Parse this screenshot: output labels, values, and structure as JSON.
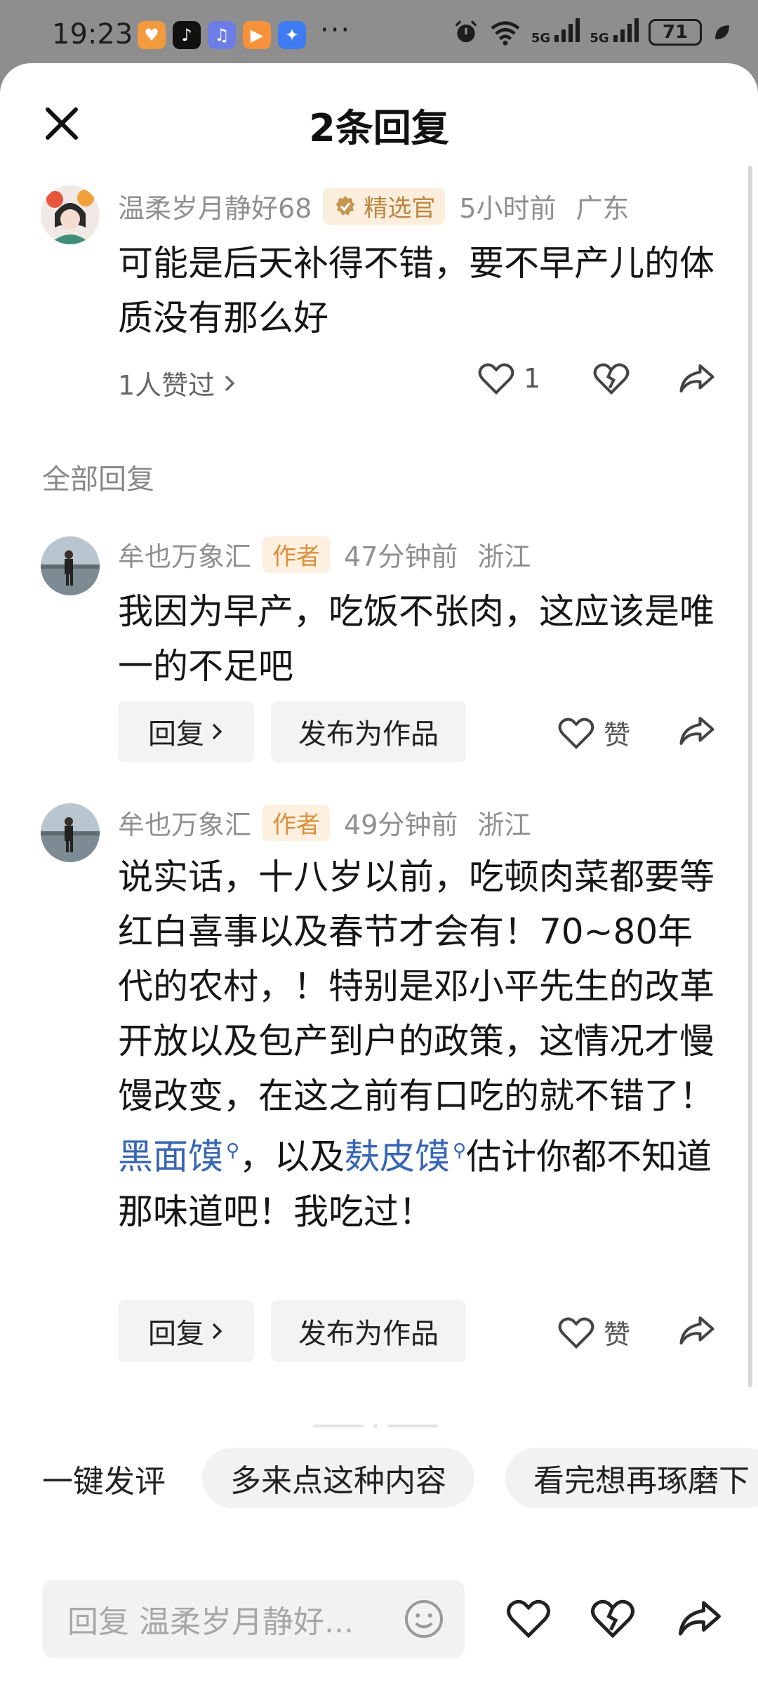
{
  "status_bar": {
    "time": "19:23",
    "app_icons": [
      "heart-app-icon",
      "tiktok-app-icon",
      "music-app-icon",
      "video-app-icon",
      "compass-app-icon"
    ],
    "more": "···",
    "signal_1": "5G",
    "signal_2": "5G",
    "battery": "71"
  },
  "header": {
    "title": "2条回复",
    "close_icon": "close-icon"
  },
  "top_comment": {
    "user": "温柔岁月静好68",
    "badge": "精选官",
    "time": "5小时前",
    "location": "广东",
    "text": "可能是后天补得不错，要不早产儿的体质没有那么好",
    "likes_summary": "1人赞过",
    "like_count": "1"
  },
  "section_label": "全部回复",
  "replies": [
    {
      "user": "牟也万象汇",
      "badge": "作者",
      "time": "47分钟前",
      "location": "浙江",
      "text": "我因为早产，吃饭不张肉，这应该是唯一的不足吧",
      "reply_label": "回复",
      "publish_label": "发布为作品",
      "like_label": "赞"
    },
    {
      "user": "牟也万象汇",
      "badge": "作者",
      "time": "49分钟前",
      "location": "浙江",
      "text_part1": "说实话，十八岁以前，吃顿肉菜都要等红白喜事以及春节才会有！70~80年代的农村，！特别是邓小平先生的改革开放以及包产到户的政策，这情况才慢馒改变，在这之前有口吃的就不错了！",
      "link1": "黑面馍",
      "text_part2": "，以及",
      "link2": "麸皮馍",
      "text_part3": "估计你都不知道那味道吧！我吃过！",
      "reply_label": "回复",
      "publish_label": "发布为作品",
      "like_label": "赞"
    }
  ],
  "quick_comment": {
    "label": "一键发评",
    "chips": [
      "多来点这种内容",
      "看完想再琢磨下"
    ]
  },
  "reply_input": {
    "placeholder": "回复 温柔岁月静好..."
  },
  "colors": {
    "link": "#3766b3",
    "selected_badge_text": "#b98640",
    "author_badge_text": "#d9903b",
    "meta_text": "#8f8f8f"
  }
}
